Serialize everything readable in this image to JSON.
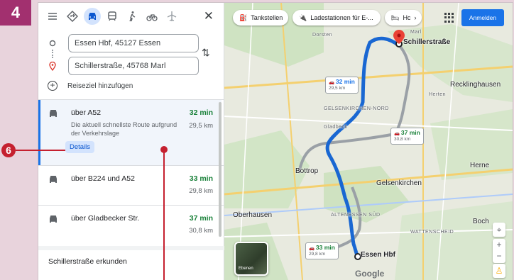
{
  "step_badge": "4",
  "annotation_number": "6",
  "panel": {
    "modes": [
      "best-route-icon",
      "car-icon",
      "transit-icon",
      "walk-icon",
      "bicycle-icon",
      "flight-icon"
    ],
    "origin": "Essen Hbf, 45127 Essen",
    "destination": "Schillerstraße, 45768 Marl",
    "add_destination": "Reiseziel hinzufügen",
    "routes": [
      {
        "name": "über A52",
        "time": "32 min",
        "distance": "29,5 km",
        "desc": "Die aktuell schnellste Route aufgrund der Verkehrslage",
        "details": "Details",
        "time_color": "#188038"
      },
      {
        "name": "über B224 und A52",
        "time": "33 min",
        "distance": "29,8 km",
        "time_color": "#188038"
      },
      {
        "name": "über Gladbecker Str.",
        "time": "37 min",
        "distance": "30,8 km",
        "time_color": "#188038"
      }
    ],
    "explore": "Schillerstraße erkunden"
  },
  "map": {
    "chips": [
      "Tankstellen",
      "Ladestationen für E-...",
      "Hc"
    ],
    "sign_in": "Anmelden",
    "places": {
      "recklinghausen": "Recklinghausen",
      "gelsenkirchen": "Gelsenkirchen",
      "bottrop": "Bottrop",
      "herne": "Herne",
      "oberhausen": "Oberhausen",
      "bochum": "Boch",
      "dorsten": "Dorsten",
      "marl": "Marl",
      "herten": "Herten",
      "gelsenkirchen_nord": "GELSENKIRCHEN-NORD",
      "altenessen": "ALTENESSEN SÜD",
      "wattenscheid": "WATTENSCHEID",
      "gladbeck": "Gladbeck"
    },
    "origin_label": "Essen Hbf",
    "destination_label": "Schillerstraße",
    "callouts": [
      {
        "time": "32 min",
        "dist": "29,5 km"
      },
      {
        "time": "37 min",
        "dist": "30,8 km"
      },
      {
        "time": "33 min",
        "dist": "29,8 km"
      }
    ],
    "layers_label": "Ebenen",
    "logo": "Google",
    "route_color": "#1a73e8",
    "alt_route_color": "#9aa0a6"
  }
}
